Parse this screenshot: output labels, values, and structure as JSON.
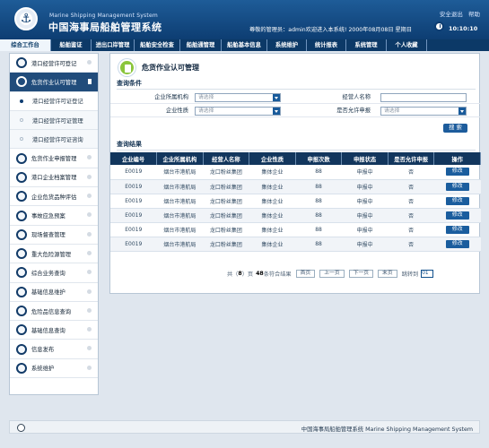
{
  "header": {
    "title_en": "Marine Shipping Management System",
    "title_cn": "中国海事局船舶管理系统",
    "links": [
      "安全退出",
      "帮助"
    ],
    "welcome": "尊敬的管理员：admin欢迎进入本系统! 2000年08月08日 星期日",
    "time": "10:10:10"
  },
  "nav": {
    "items": [
      "综合工作台",
      "船舶鉴证",
      "进出口岸管理",
      "船舶安全检查",
      "船舶通管理",
      "船舶基本信息",
      "系统维护",
      "统计报表",
      "系统管理",
      "个人收藏"
    ]
  },
  "sidebar": {
    "items": [
      {
        "label": "港口经营许可登记",
        "state": "normal",
        "icon": "document-icon"
      },
      {
        "label": "危货作业认可管理",
        "state": "active",
        "icon": "shield-icon"
      },
      {
        "label": "港口经营许可证登记",
        "state": "sub-active",
        "icon": "dot"
      },
      {
        "label": "港口经营许可证管理",
        "state": "sub",
        "icon": "dot"
      },
      {
        "label": "港口经营许可证咨询",
        "state": "sub",
        "icon": "dot"
      },
      {
        "label": "危货作业申报管理",
        "state": "normal",
        "icon": "wrench-icon"
      },
      {
        "label": "港口企业档案管理",
        "state": "normal",
        "icon": "folder-icon"
      },
      {
        "label": "企业危货品种评估",
        "state": "normal",
        "icon": "gear-icon"
      },
      {
        "label": "事故应急预案",
        "state": "normal",
        "icon": "alarm-icon"
      },
      {
        "label": "现场督查管理",
        "state": "normal",
        "icon": "heart-icon"
      },
      {
        "label": "重大危险源管理",
        "state": "normal",
        "icon": "warning-icon"
      },
      {
        "label": "综合业务查询",
        "state": "normal",
        "icon": "menu-icon"
      },
      {
        "label": "基础信息维护",
        "state": "normal",
        "icon": "cog-icon"
      },
      {
        "label": "危险品信息查询",
        "state": "normal",
        "icon": "search-icon"
      },
      {
        "label": "基础信息查询",
        "state": "normal",
        "icon": "chat-icon"
      },
      {
        "label": "信息发布",
        "state": "normal",
        "icon": "power-icon"
      },
      {
        "label": "系统维护",
        "state": "normal",
        "icon": "tools-icon"
      }
    ]
  },
  "main": {
    "title": "危货作业认可管理",
    "query_title": "查询条件",
    "query": {
      "labels": [
        "企业所属机构",
        "经营人名称",
        "企业性质",
        "是否允许申报"
      ],
      "placeholders": [
        "请选择",
        "请选择",
        "请选择"
      ],
      "search_label": "搜 索"
    },
    "results_title": "查询结果",
    "table": {
      "headers": [
        "企业编号",
        "企业所属机构",
        "经营人名称",
        "企业性质",
        "申报次数",
        "申报状态",
        "是否允许申报",
        "操作"
      ],
      "rows": [
        [
          "E0019",
          "烟台市港航局",
          "龙口粉丝集团",
          "集体企业",
          "88",
          "申报中",
          "否",
          "修改"
        ],
        [
          "E0019",
          "烟台市港航局",
          "龙口粉丝集团",
          "集体企业",
          "88",
          "申报中",
          "否",
          "修改"
        ],
        [
          "E0019",
          "烟台市港航局",
          "龙口粉丝集团",
          "集体企业",
          "88",
          "申报中",
          "否",
          "修改"
        ],
        [
          "E0019",
          "烟台市港航局",
          "龙口粉丝集团",
          "集体企业",
          "88",
          "申报中",
          "否",
          "修改"
        ],
        [
          "E0019",
          "烟台市港航局",
          "龙口粉丝集团",
          "集体企业",
          "88",
          "申报中",
          "否",
          "修改"
        ],
        [
          "E0019",
          "烟台市港航局",
          "龙口粉丝集团",
          "集体企业",
          "88",
          "申报中",
          "否",
          "修改"
        ]
      ]
    },
    "pager": {
      "summary_prefix": "共（",
      "pages": "8",
      "summary_mid": "）页",
      "count": "48",
      "summary_suffix": "条符合结果",
      "buttons": [
        "首页",
        "上一页",
        "下一页",
        "末页"
      ],
      "jump_label": "跳转到",
      "jump_value": "01"
    }
  },
  "footer": {
    "text": "中国海事局船舶管理系统 Marine Shipping Management System"
  },
  "colors": {
    "header": "#0d3d72",
    "nav": "#0c3967",
    "accent": "#1d5c9c",
    "green": "#8ac53c"
  }
}
